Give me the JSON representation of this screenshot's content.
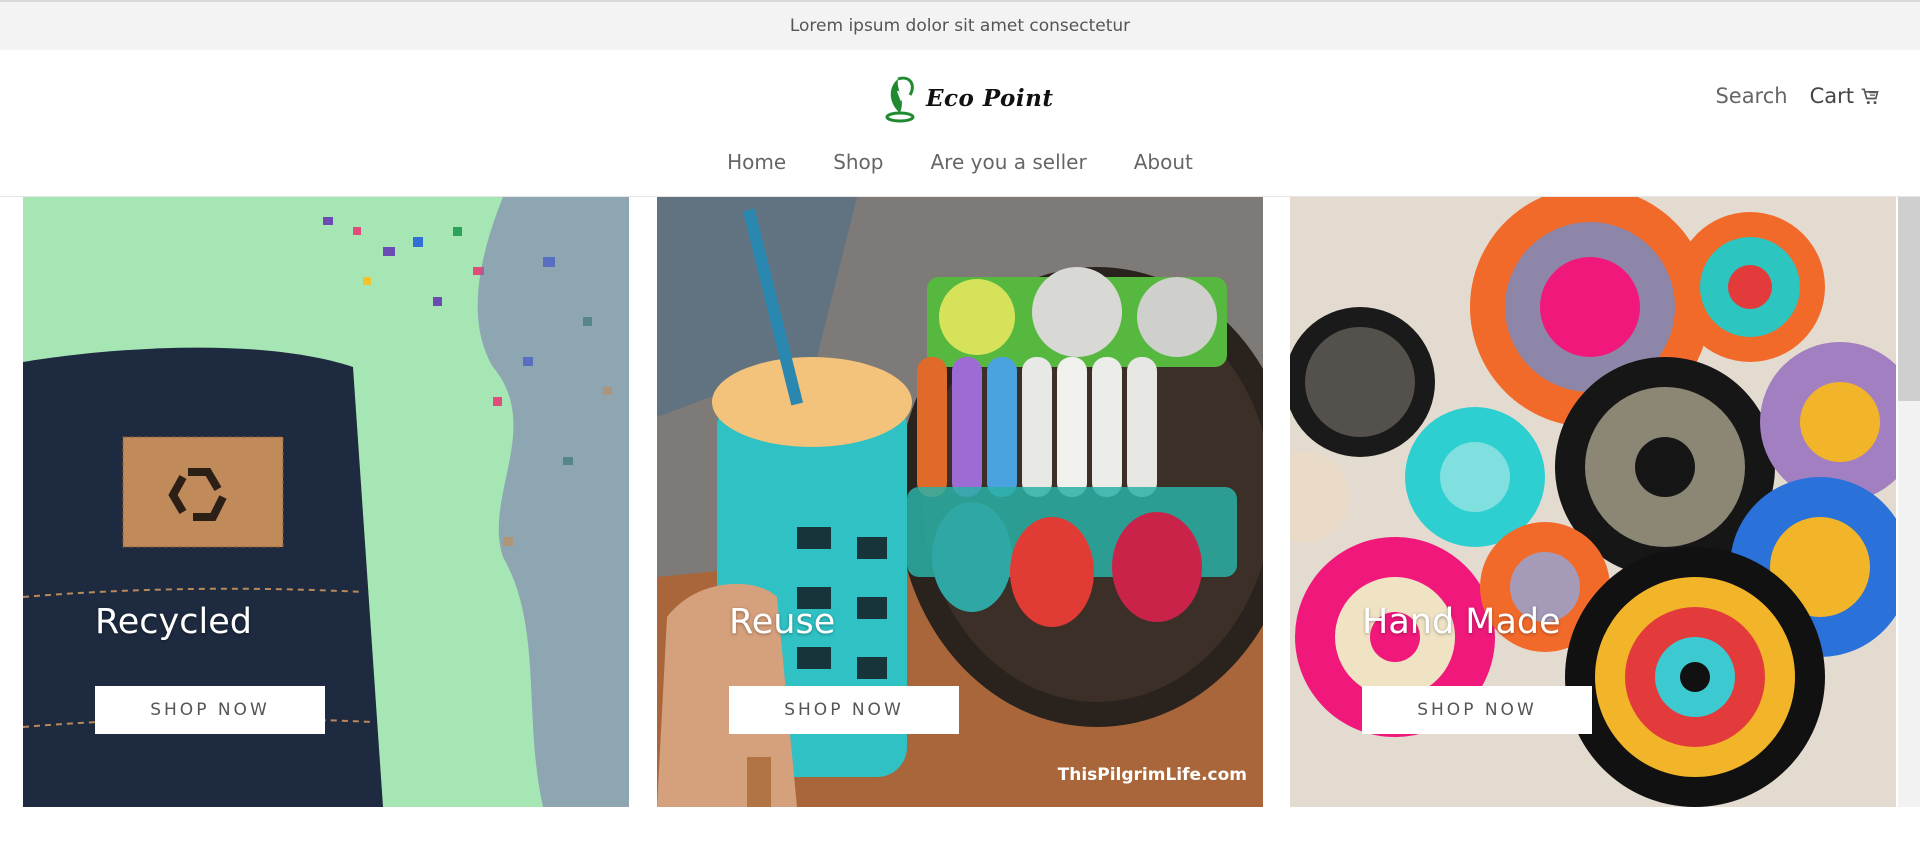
{
  "announcement": "Lorem ipsum dolor sit amet consectetur",
  "header": {
    "logo_text": "Eco Point",
    "search_label": "Search",
    "cart_label": "Cart",
    "icons": [
      "leaf-globe-logo",
      "cart-icon"
    ]
  },
  "nav": {
    "items": [
      {
        "label": "Home"
      },
      {
        "label": "Shop"
      },
      {
        "label": "Are you a seller"
      },
      {
        "label": "About"
      }
    ]
  },
  "cards": [
    {
      "title": "Recycled",
      "button": "SHOP NOW"
    },
    {
      "title": "Reuse",
      "button": "SHOP NOW",
      "watermark": "ThisPilgrimLife.com"
    },
    {
      "title": "Hand Made",
      "button": "SHOP NOW"
    }
  ],
  "colors": {
    "announce_bg": "#f3f3f3",
    "mint": "#a6e6b4",
    "denim": "#1e2a3f",
    "teal": "#2fb5b1",
    "linen": "#e4dbd0",
    "logo_green": "#1f8a2f"
  }
}
